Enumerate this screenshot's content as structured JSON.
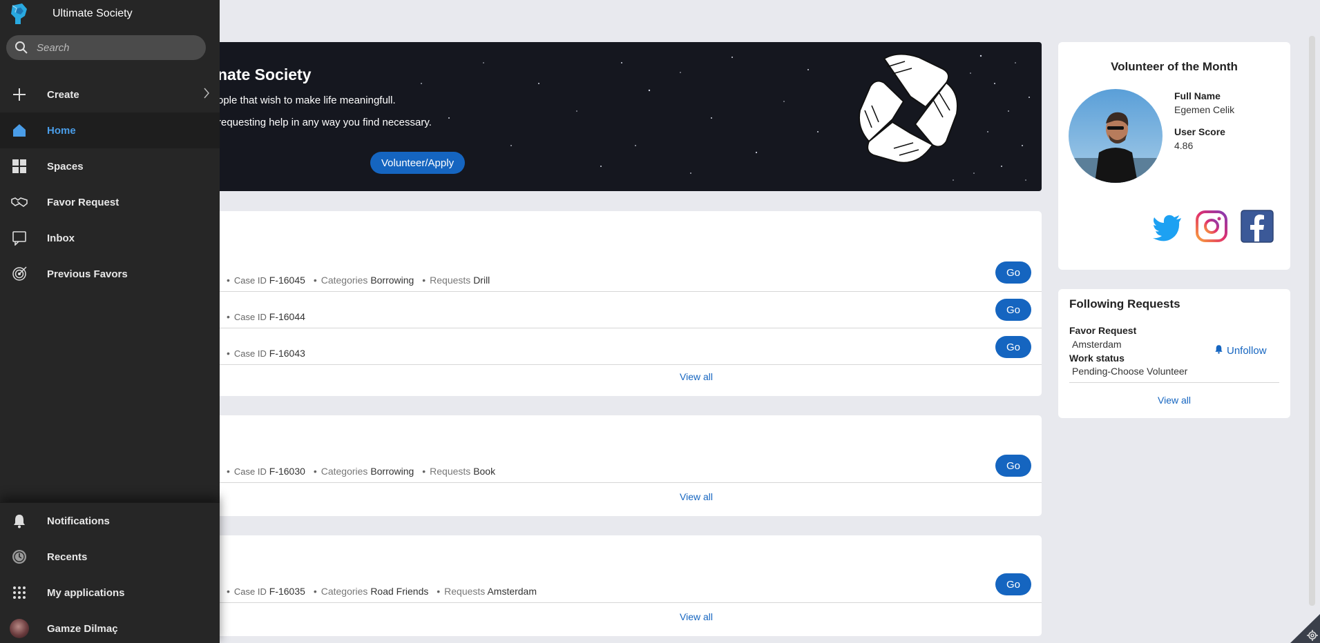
{
  "sidebar": {
    "app_title": "Ultimate Society",
    "search_placeholder": "Search",
    "items": [
      {
        "label": "Create",
        "icon": "plus-icon"
      },
      {
        "label": "Home",
        "icon": "home-icon",
        "active": true
      },
      {
        "label": "Spaces",
        "icon": "grid-icon"
      },
      {
        "label": "Favor Request",
        "icon": "handshake-icon"
      },
      {
        "label": "Inbox",
        "icon": "inbox-icon"
      },
      {
        "label": "Previous Favors",
        "icon": "target-icon"
      }
    ],
    "bottom_items": [
      {
        "label": "Notifications",
        "icon": "bell-icon"
      },
      {
        "label": "Recents",
        "icon": "history-icon"
      },
      {
        "label": "My applications",
        "icon": "apps-icon"
      },
      {
        "label": "Gamze Dilmaç",
        "icon": "avatar"
      }
    ]
  },
  "banner": {
    "title": "nate Society",
    "line1": "ople that wish to make life meaningfull.",
    "line2": "requesting help in any way you find necessary.",
    "button": "Volunteer/Apply"
  },
  "labels": {
    "case_id": "Case ID",
    "categories": "Categories",
    "requests": "Requests",
    "go": "Go",
    "view_all": "View all",
    "bullet": "•"
  },
  "cards": [
    {
      "rows": [
        {
          "case_id": "F-16045",
          "category": "Borrowing",
          "request": "Drill"
        },
        {
          "case_id": "F-16044"
        },
        {
          "case_id": "F-16043"
        }
      ]
    },
    {
      "rows": [
        {
          "case_id": "F-16030",
          "category": "Borrowing",
          "request": "Book"
        }
      ]
    },
    {
      "rows": [
        {
          "case_id": "F-16035",
          "category": "Road Friends",
          "request": "Amsterdam"
        }
      ]
    }
  ],
  "volunteer": {
    "heading": "Volunteer of the Month",
    "full_name_label": "Full Name",
    "full_name": "Egemen Celik",
    "score_label": "User Score",
    "score": "4.86",
    "social": [
      "twitter-icon",
      "instagram-icon",
      "facebook-icon"
    ]
  },
  "following": {
    "heading": "Following Requests",
    "favor_label": "Favor Request",
    "favor_value": "Amsterdam",
    "status_label": "Work status",
    "status_value": "Pending-Choose Volunteer",
    "unfollow": "Unfollow",
    "view_all": "View all"
  },
  "colors": {
    "sidebar_bg": "#262626",
    "accent": "#1565c0",
    "active_text": "#4a9de8",
    "page_bg": "#e8e9ee"
  }
}
